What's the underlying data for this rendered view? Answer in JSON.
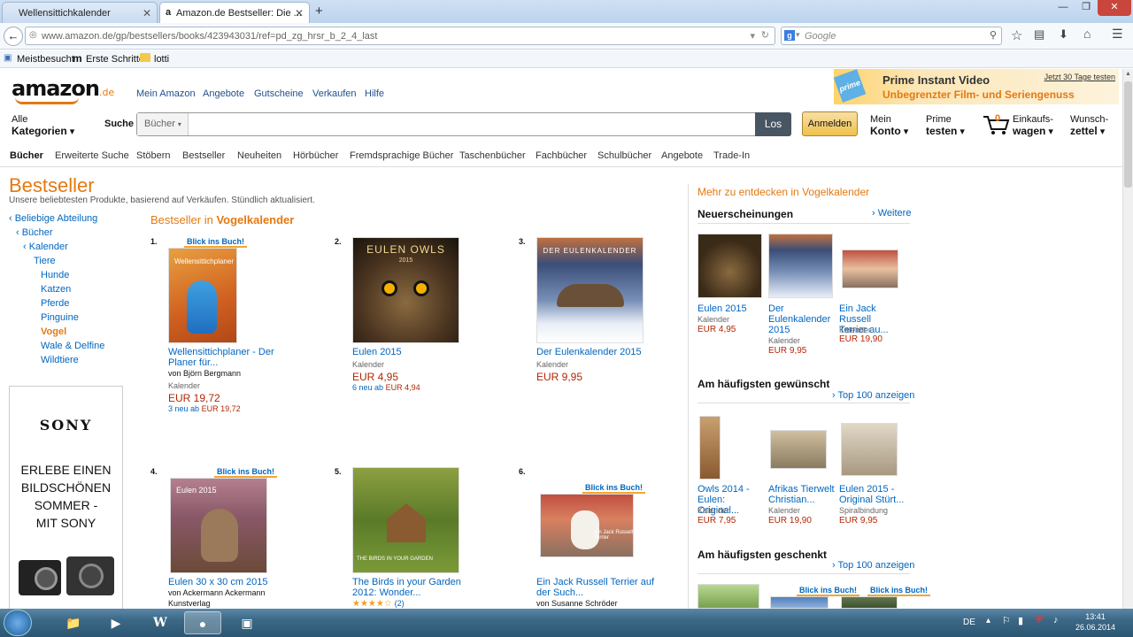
{
  "browser": {
    "tabs": [
      {
        "label": "Wellensittichkalender"
      },
      {
        "label": "Amazon.de Bestseller: Die ..."
      }
    ],
    "url": "www.amazon.de/gp/bestsellers/books/423943031/ref=pd_zg_hrsr_b_2_4_last",
    "search_placeholder": "Google",
    "bookmarks": [
      "Meistbesucht",
      "Erste Schritte",
      "lotti"
    ]
  },
  "header": {
    "logo": "amazon",
    "logo_tld": ".de",
    "links": [
      "Mein Amazon",
      "Angebote",
      "Gutscheine",
      "Verkaufen",
      "Hilfe"
    ],
    "prime": {
      "title": "Prime Instant Video",
      "subtitle": "Unbegrenzter Film- und Seriengenuss",
      "link": "Jetzt 30 Tage testen",
      "badge": "prime"
    },
    "alle": "Alle",
    "kategorien": "Kategorien",
    "suche_label": "Suche",
    "scope": "Bücher",
    "search_button": "Los",
    "signin": "Anmelden",
    "konto_top": "Mein",
    "konto_bottom": "Konto",
    "prime_top": "Prime",
    "prime_bottom": "testen",
    "cart_count": "0",
    "cart_top": "Einkaufs-",
    "cart_bottom": "wagen",
    "wish_top": "Wunsch-",
    "wish_bottom": "zettel"
  },
  "subnav": [
    "Bücher",
    "Erweiterte Suche",
    "Stöbern",
    "Bestseller",
    "Neuheiten",
    "Hörbücher",
    "Fremdsprachige Bücher",
    "Taschenbücher",
    "Fachbücher",
    "Schulbücher",
    "Angebote",
    "Trade-In"
  ],
  "page": {
    "title": "Bestseller",
    "description": "Unsere beliebtesten Produkte, basierend auf Verkäufen. Stündlich aktualisiert.",
    "bestseller_in": "Bestseller in",
    "category": "Vogelkalender"
  },
  "categories": [
    "‹ Beliebige Abteilung",
    "‹ Bücher",
    "‹ Kalender",
    "Tiere",
    "Hunde",
    "Katzen",
    "Pferde",
    "Pinguine",
    "Vogel",
    "Wale & Delfine",
    "Wildtiere"
  ],
  "ad": {
    "brand": "SONY",
    "text": [
      "ERLEBE EINEN",
      "BILDSCHÖNEN",
      "SOMMER -",
      "MIT SONY"
    ]
  },
  "products": [
    {
      "rank": "1.",
      "blick": "Blick ins Buch!",
      "cover_text": "Wellensittichplaner",
      "title1": "Wellensittichplaner - Der",
      "title2": "Planer für...",
      "by": "von Björn Bergmann",
      "format": "Kalender",
      "price": "EUR 19,72",
      "used_prefix": "3 neu ab",
      "used_price": "EUR 19,72"
    },
    {
      "rank": "2.",
      "cover_text": "EULEN OWLS",
      "cover_sub": "2015",
      "title1": "Eulen 2015",
      "format": "Kalender",
      "price": "EUR 4,95",
      "used_prefix": "6 neu ab",
      "used_price": "EUR 4,94"
    },
    {
      "rank": "3.",
      "cover_text": "DER EULENKALENDER",
      "title1": "Der Eulenkalender 2015",
      "format": "Kalender",
      "price": "EUR 9,95"
    },
    {
      "rank": "4.",
      "blick": "Blick ins Buch!",
      "cover_text": "Eulen 2015",
      "title1": "Eulen 30 x 30 cm 2015",
      "by": "von Ackermann Ackermann",
      "by2": "Kunstverlag"
    },
    {
      "rank": "5.",
      "cover_text": "THE BIRDS IN YOUR GARDEN",
      "title1": "The Birds in your Garden",
      "title2": "2012: Wonder...",
      "reviews": "(2)"
    },
    {
      "rank": "6.",
      "blick": "Blick ins Buch!",
      "cover_text": "Ein Jack Russell Terrier",
      "title1": "Ein Jack Russell Terrier auf",
      "title2": "der Such...",
      "by": "von Susanne Schröder"
    }
  ],
  "right": {
    "mehr": "Mehr zu entdecken in Vogelkalender",
    "neu_title": "Neuerscheinungen",
    "neu_link": "Weitere",
    "neu": [
      {
        "title": [
          "Eulen 2015"
        ],
        "format": "Kalender",
        "price": "EUR 4,95"
      },
      {
        "title": [
          "Der",
          "Eulenkalender",
          "2015"
        ],
        "format": "Kalender",
        "price": "EUR 9,95"
      },
      {
        "title": [
          "Ein Jack Russell",
          "Terrier au..."
        ],
        "format": "Kalender",
        "price": "EUR 19,90"
      }
    ],
    "wish_title": "Am häufigsten gewünscht",
    "wish_link": "Top 100 anzeigen",
    "wish": [
      {
        "title": [
          "Owls 2014 -",
          "Eulen: Original..."
        ],
        "format": "Kalender",
        "price": "EUR 7,95"
      },
      {
        "title": [
          "Afrikas Tierwelt",
          "Christian..."
        ],
        "format": "Kalender",
        "price": "EUR 19,90"
      },
      {
        "title": [
          "Eulen 2015 -",
          "Original Stürt..."
        ],
        "format": "Spiralbindung",
        "price": "EUR 9,95"
      }
    ],
    "gift_title": "Am häufigsten geschenkt",
    "gift_link": "Top 100 anzeigen",
    "gift_blick": "Blick ins Buch!"
  },
  "taskbar": {
    "lang": "DE",
    "time": "13:41",
    "date": "26.06.2014"
  }
}
